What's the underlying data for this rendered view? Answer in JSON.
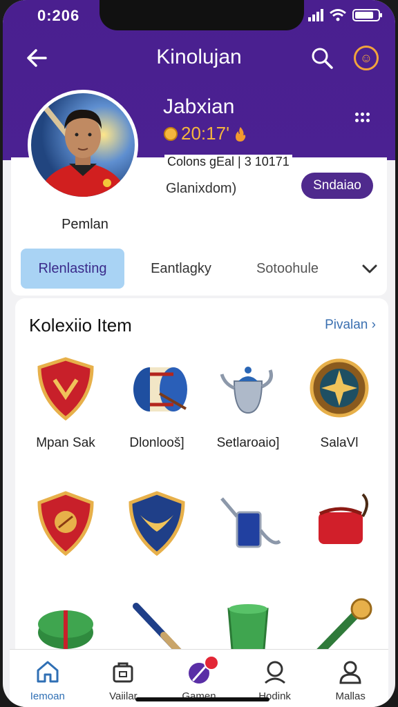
{
  "status": {
    "time": "0:206"
  },
  "header": {
    "title": "Kinolujan"
  },
  "profile": {
    "username": "Jabxian",
    "points": "20:17'",
    "stats": "Colons gEal | 3 10171",
    "subtitle": "Glanixdom)",
    "subscribe_label": "Sndaiao",
    "avatar_name": "Pemlan"
  },
  "tabs": [
    {
      "label": "Rlenlasting"
    },
    {
      "label": "Eantlagky"
    },
    {
      "label": "Sotoohule"
    }
  ],
  "collection": {
    "title": "Kolexiio Item",
    "link": "Pivalan",
    "items": [
      {
        "label": "Mpan Sak",
        "icon": "red-shield-icon"
      },
      {
        "label": "Dlonlooš]",
        "icon": "drum-icon"
      },
      {
        "label": "Setlaroaio]",
        "icon": "teapot-icon"
      },
      {
        "label": "SalaVl",
        "icon": "star-medal-icon"
      },
      {
        "label": "",
        "icon": "red-ball-shield-icon"
      },
      {
        "label": "",
        "icon": "blue-wing-shield-icon"
      },
      {
        "label": "",
        "icon": "watering-can-icon"
      },
      {
        "label": "",
        "icon": "red-bag-icon"
      },
      {
        "label": "",
        "icon": "green-box-icon"
      },
      {
        "label": "",
        "icon": "bat-icon"
      },
      {
        "label": "",
        "icon": "green-bucket-icon"
      },
      {
        "label": "",
        "icon": "green-horn-icon"
      }
    ]
  },
  "bottom_nav": [
    {
      "label": "Iemoan",
      "icon": "home-icon"
    },
    {
      "label": "Vaiilar",
      "icon": "bag-icon"
    },
    {
      "label": "Gamen",
      "icon": "magic-wand-icon"
    },
    {
      "label": "Hodink",
      "icon": "profile-icon"
    },
    {
      "label": "Mallas",
      "icon": "user-icon"
    }
  ],
  "colors": {
    "header": "#4b2192",
    "accent": "#f5b63e",
    "active_tab": "#a9d3f4",
    "subscribe": "#4f2a8d",
    "link": "#3a6fb0"
  }
}
